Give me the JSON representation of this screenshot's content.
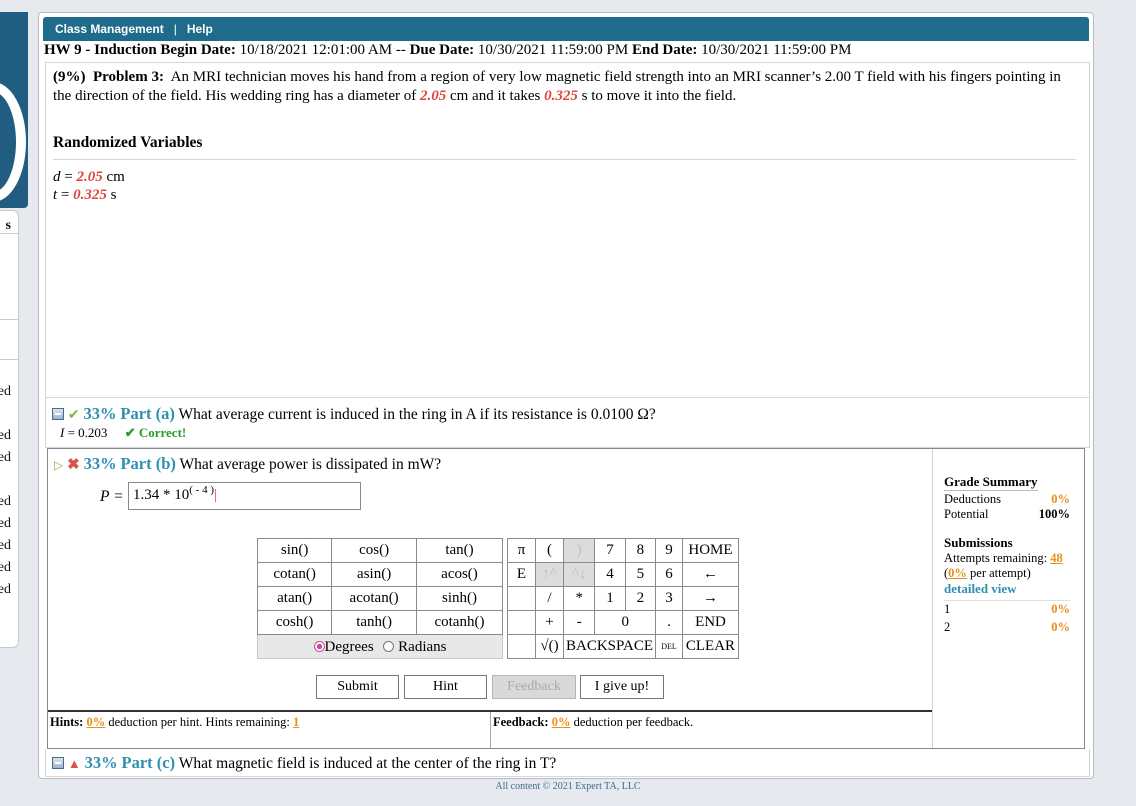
{
  "nav": {
    "class_management": "Class Management",
    "separator": "|",
    "help": "Help"
  },
  "hw": {
    "title": "HW 9 - Induction",
    "begin_label": "Begin Date:",
    "begin_value": "10/18/2021 12:01:00 AM -- ",
    "due_label": "Due Date:",
    "due_value": "10/30/2021 11:59:00 PM",
    "end_label": "End Date:",
    "end_value": "10/30/2021 11:59:00 PM"
  },
  "problem": {
    "percent": "(9%)",
    "label": "Problem 3:",
    "text1": "An MRI technician moves his hand from a region of very low magnetic field strength into an MRI scanner’s 2.00 T field with his fingers pointing in the direction of the field. His wedding ring has a diameter of",
    "diameter": "2.05",
    "text2": "cm and it takes",
    "time": "0.325",
    "text3": "s to move it into the field.",
    "rv_title": "Randomized Variables",
    "var_d": {
      "name": "d",
      "eq": " = ",
      "value": "2.05",
      "unit": " cm"
    },
    "var_t": {
      "name": "t",
      "eq": " = ",
      "value": "0.325",
      "unit": " s"
    }
  },
  "part_a": {
    "pct": "33%",
    "label": "Part (a)",
    "question": "What average current is induced in the ring in A if its resistance is 0.0100 Ω?",
    "answer_var": "I",
    "answer_value": " = 0.203",
    "status": "✔ Correct!"
  },
  "part_b": {
    "pct": "33%",
    "label": "Part (b)",
    "question": "What average power is dissipated in mW?",
    "input_label": "P =",
    "input_value": "1.34 * 10",
    "input_exp": "( - 4 )",
    "trig_rows": [
      [
        "sin()",
        "cos()",
        "tan()"
      ],
      [
        "cotan()",
        "asin()",
        "acos()"
      ],
      [
        "atan()",
        "acotan()",
        "sinh()"
      ],
      [
        "cosh()",
        "tanh()",
        "cotanh()"
      ]
    ],
    "angle_degrees": "Degrees",
    "angle_radians": "Radians",
    "keys": {
      "pi": "π",
      "lparen": "(",
      "rparen": ")",
      "seven": "7",
      "eight": "8",
      "nine": "9",
      "home": "HOME",
      "e": "E",
      "up": "↑^",
      "down": "^↓",
      "four": "4",
      "five": "5",
      "six": "6",
      "left": "←",
      "slash": "/",
      "star": "*",
      "one": "1",
      "two": "2",
      "three": "3",
      "right": "→",
      "plus": "+",
      "minus": "-",
      "zero": "0",
      "dot": ".",
      "end": "END",
      "sqrt": "√()",
      "backspace": "BACKSPACE",
      "del": "DEL",
      "clear": "CLEAR"
    },
    "buttons": {
      "submit": "Submit",
      "hint": "Hint",
      "feedback": "Feedback",
      "give_up": "I give up!"
    },
    "hints": {
      "label": "Hints:",
      "pct": "0%",
      "text": "deduction per hint. Hints remaining:",
      "remaining": "1"
    },
    "feedback": {
      "label": "Feedback:",
      "pct": "0%",
      "text": "deduction per feedback."
    }
  },
  "grade_summary": {
    "title": "Grade Summary",
    "deductions_label": "Deductions",
    "deductions_value": "0%",
    "potential_label": "Potential",
    "potential_value": "100%"
  },
  "submissions": {
    "title": "Submissions",
    "attempts_label": "Attempts remaining:",
    "attempts_value": "48",
    "per_open": "(",
    "per_value": "0%",
    "per_text": "per attempt)",
    "detailed": "detailed view",
    "rows": [
      {
        "n": "1",
        "v": "0%"
      },
      {
        "n": "2",
        "v": "0%"
      }
    ]
  },
  "part_c": {
    "pct": "33%",
    "label": "Part (c)",
    "question": "What magnetic field is induced at the center of the ring in T?"
  },
  "footer": "All content © 2021 Expert TA, LLC",
  "left_fragments": [
    "s",
    "ed",
    "ed",
    "ed",
    "ed",
    "ed",
    "ed",
    "ed",
    "ed"
  ]
}
